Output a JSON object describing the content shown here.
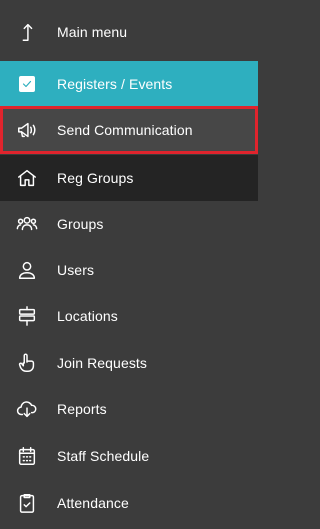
{
  "menu": {
    "items": [
      {
        "label": "Main menu",
        "icon": "arrow-up-icon"
      },
      {
        "label": "Registers / Events",
        "icon": "checkbox-icon"
      },
      {
        "label": "Send Communication",
        "icon": "megaphone-icon"
      },
      {
        "label": "Reg Groups",
        "icon": "home-icon"
      },
      {
        "label": "Groups",
        "icon": "people-icon"
      },
      {
        "label": "Users",
        "icon": "user-icon"
      },
      {
        "label": "Locations",
        "icon": "signpost-icon"
      },
      {
        "label": "Join Requests",
        "icon": "hand-pointer-icon"
      },
      {
        "label": "Reports",
        "icon": "cloud-download-icon"
      },
      {
        "label": "Staff Schedule",
        "icon": "calendar-icon"
      },
      {
        "label": "Attendance",
        "icon": "clipboard-check-icon"
      }
    ]
  },
  "colors": {
    "background": "#3c3c3c",
    "active_teal": "#2eafbf",
    "dark_row": "#242424",
    "highlight_border": "#e0242d"
  }
}
